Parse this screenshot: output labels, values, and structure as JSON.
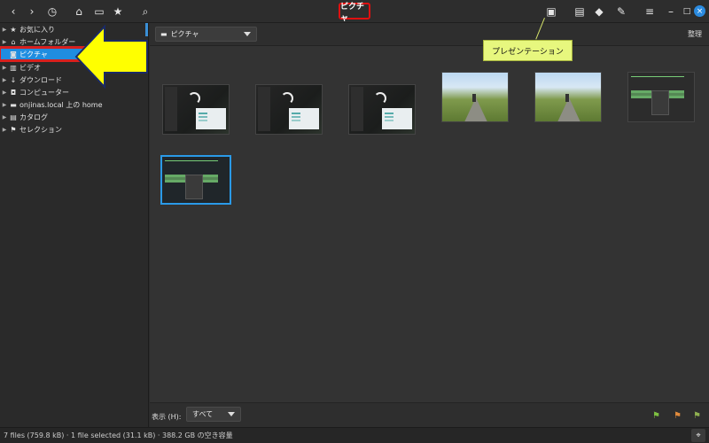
{
  "titlebar": {
    "title": "ピクチャ",
    "nav_icons": [
      "back-icon",
      "forward-icon",
      "history-icon",
      "home-icon",
      "drive-icon",
      "star-icon",
      "search-icon"
    ],
    "right_icons": [
      "presentation-icon",
      "chat-icon",
      "tag-icon",
      "wrench-icon",
      "menu-icon",
      "minimize-icon",
      "maximize-icon",
      "close-icon"
    ]
  },
  "sidebar": {
    "items": [
      {
        "label": "お気に入り",
        "icon": "star-icon"
      },
      {
        "label": "ホームフォルダー",
        "icon": "home-icon"
      },
      {
        "label": "ピクチャ",
        "icon": "camera-icon",
        "selected": true
      },
      {
        "label": "ビデオ",
        "icon": "film-icon"
      },
      {
        "label": "ダウンロード",
        "icon": "download-icon"
      },
      {
        "label": "コンピューター",
        "icon": "computer-icon"
      },
      {
        "label": "onjinas.local 上の home",
        "icon": "network-drive-icon"
      },
      {
        "label": "カタログ",
        "icon": "catalog-icon"
      },
      {
        "label": "セレクション",
        "icon": "flag-icon"
      }
    ]
  },
  "toolbar": {
    "path_value": "ピクチャ",
    "organize_label": "整理"
  },
  "tooltip": {
    "text": "プレゼンテーション"
  },
  "bottombar": {
    "view_label": "表示 (H):",
    "view_value": "すべて"
  },
  "status": {
    "text": "7 files (759.8 kB)  ·  1 file selected (31.1 kB)  ·  388.2 GB の空き容量"
  },
  "colors": {
    "accent": "#1f8de0",
    "highlight_red": "#e01010",
    "tooltip_bg": "#e7f77e",
    "arrow_yellow": "#ffff00"
  }
}
